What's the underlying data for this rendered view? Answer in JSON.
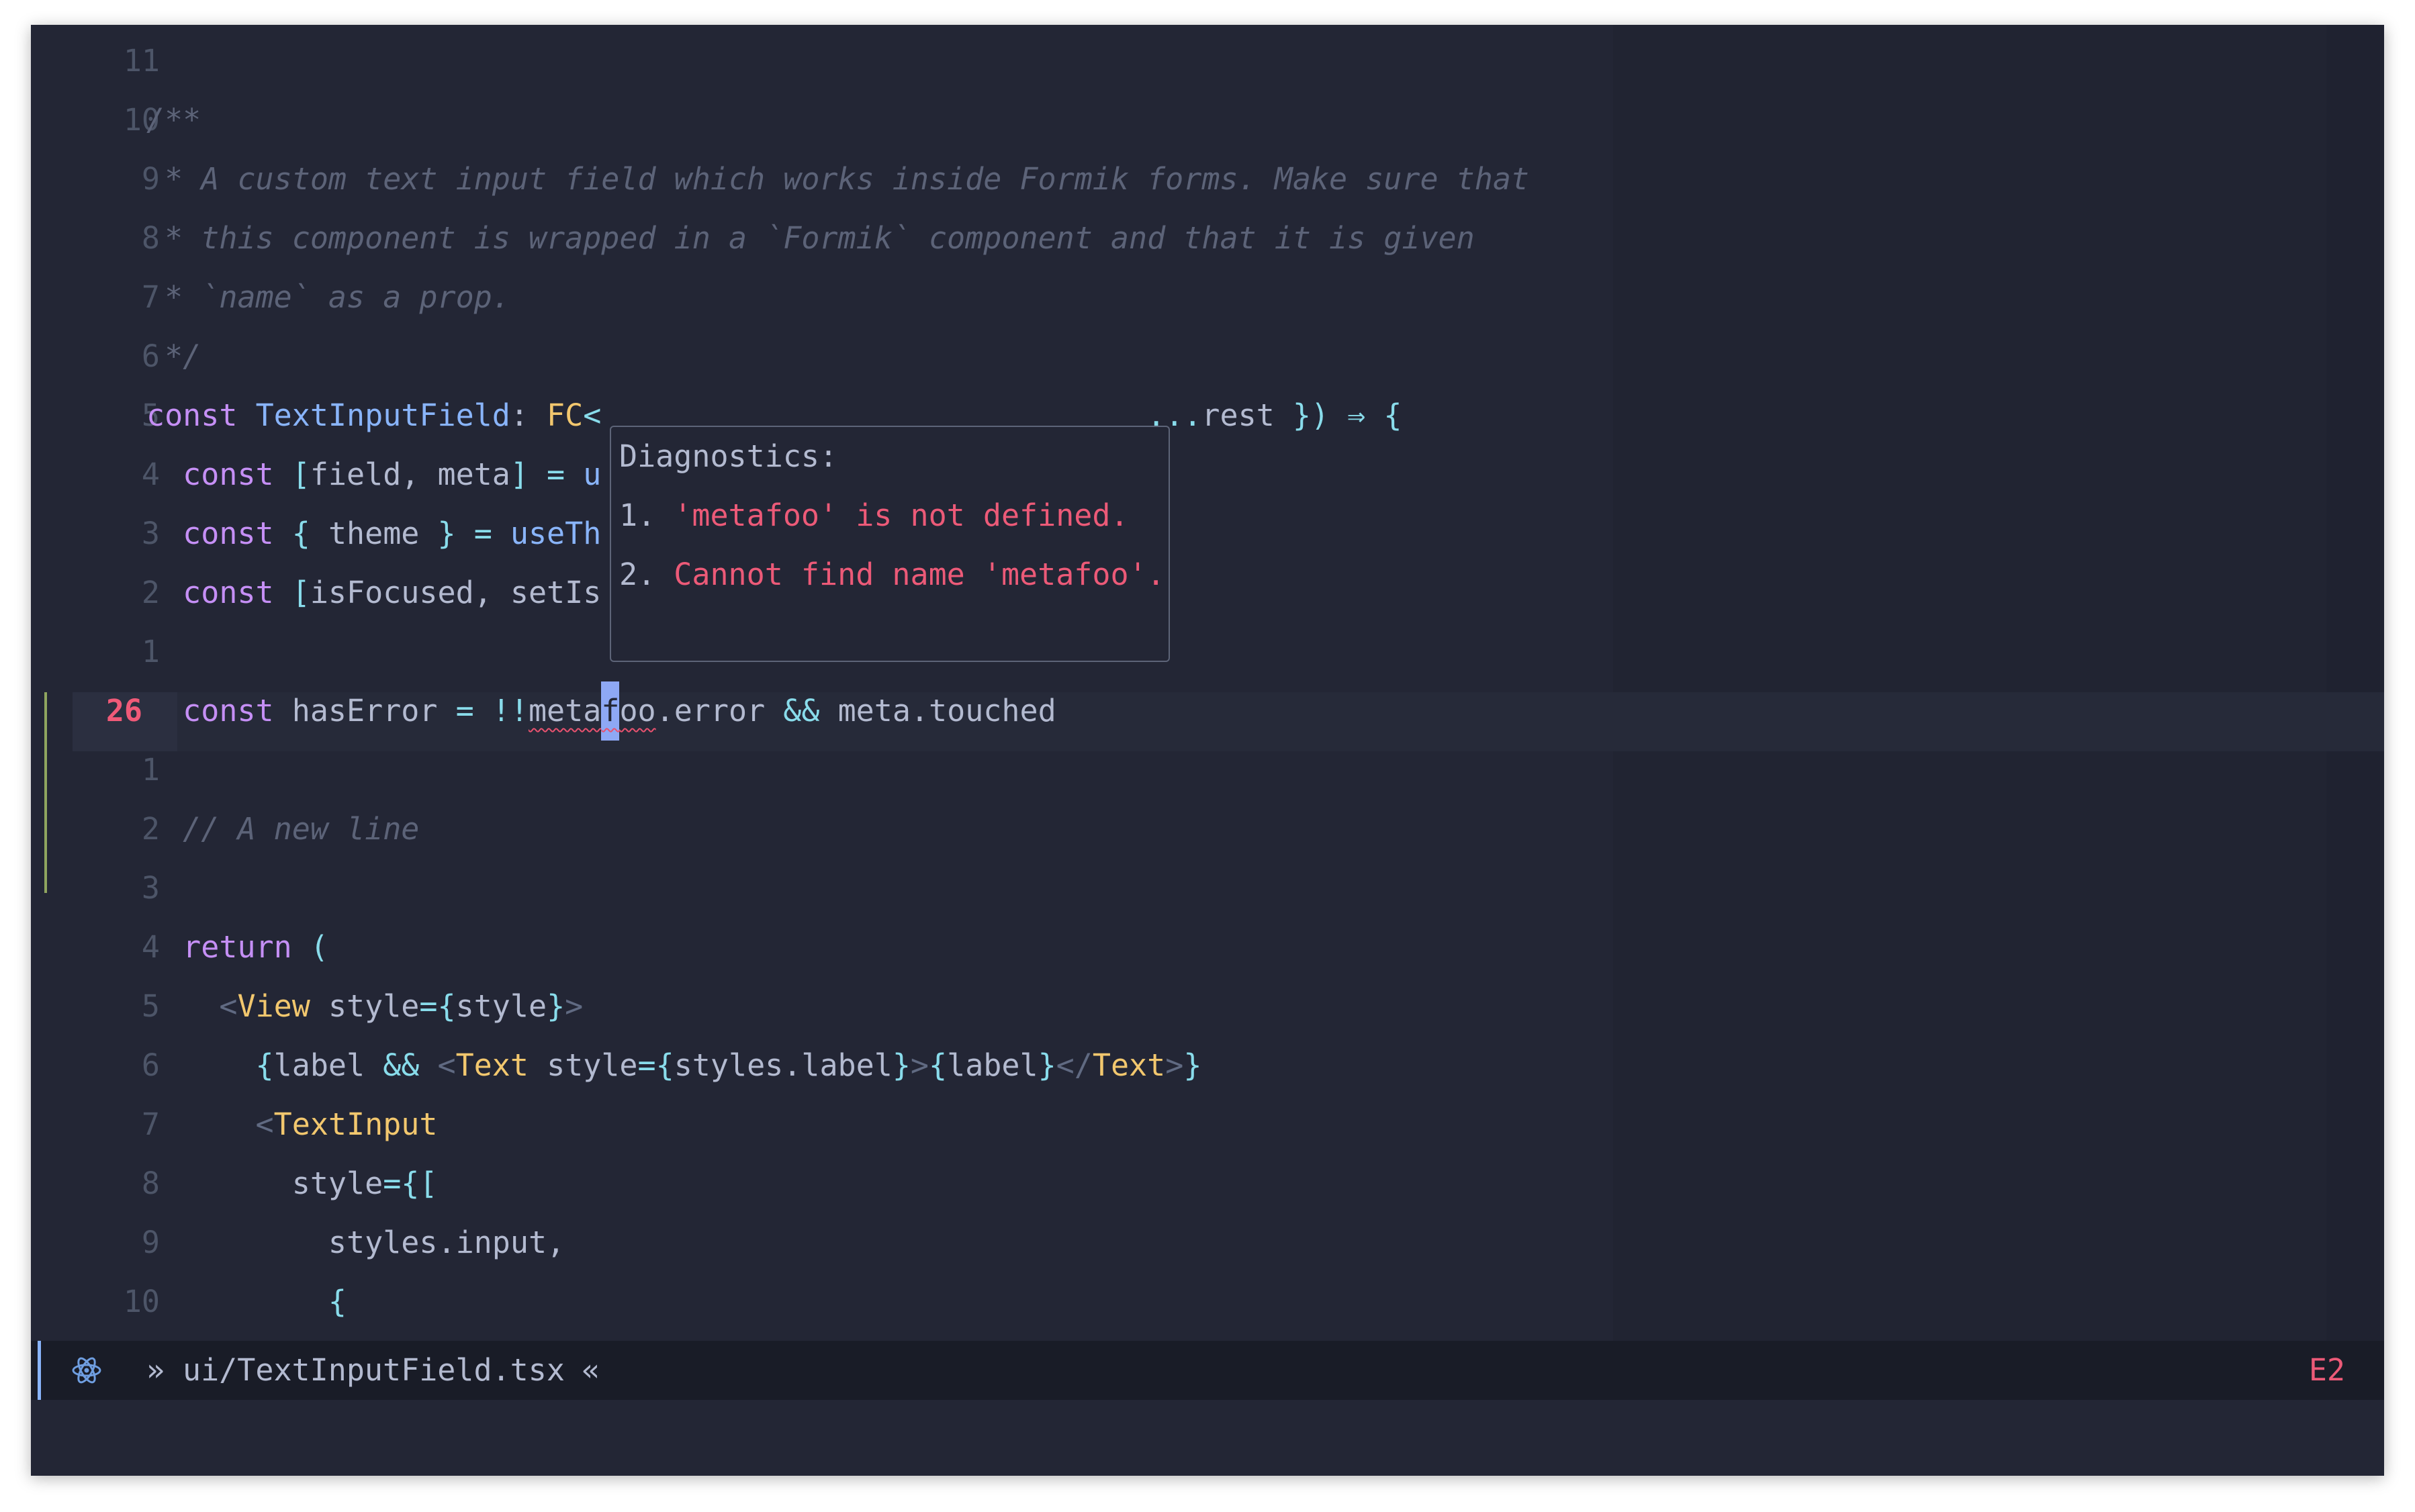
{
  "editor": {
    "lines": [
      {
        "num": "11",
        "tokens": []
      },
      {
        "num": "10",
        "tokens": [
          {
            "t": "/**",
            "c": "cm"
          }
        ]
      },
      {
        "num": "9",
        "tokens": [
          {
            "t": " * A custom text input field which works inside Formik forms. Make sure that",
            "c": "cm"
          }
        ]
      },
      {
        "num": "8",
        "tokens": [
          {
            "t": " * this component is wrapped in a `Formik` component and that it is given",
            "c": "cm"
          }
        ]
      },
      {
        "num": "7",
        "tokens": [
          {
            "t": " * `name` as a prop.",
            "c": "cm"
          }
        ]
      },
      {
        "num": "6",
        "tokens": [
          {
            "t": " */",
            "c": "cm"
          }
        ]
      },
      {
        "num": "5",
        "tokens": [
          {
            "t": "const ",
            "c": "kw"
          },
          {
            "t": "TextInputField",
            "c": "fn"
          },
          {
            "t": ": ",
            "c": "pl"
          },
          {
            "t": "FC",
            "c": "ty"
          },
          {
            "t": "<",
            "c": "op"
          },
          {
            "t": "                              ",
            "c": "pl"
          },
          {
            "t": "...",
            "c": "op"
          },
          {
            "t": "rest ",
            "c": "pl"
          },
          {
            "t": "}) ",
            "c": "op"
          },
          {
            "t": "⇒ ",
            "c": "op"
          },
          {
            "t": "{",
            "c": "op"
          }
        ]
      },
      {
        "num": "4",
        "tokens": [
          {
            "t": "  const ",
            "c": "kw"
          },
          {
            "t": "[",
            "c": "op"
          },
          {
            "t": "field, meta",
            "c": "pl"
          },
          {
            "t": "] ",
            "c": "op"
          },
          {
            "t": "= ",
            "c": "op"
          },
          {
            "t": "u",
            "c": "fn"
          }
        ]
      },
      {
        "num": "3",
        "tokens": [
          {
            "t": "  const ",
            "c": "kw"
          },
          {
            "t": "{ ",
            "c": "op"
          },
          {
            "t": "theme ",
            "c": "pl"
          },
          {
            "t": "} ",
            "c": "op"
          },
          {
            "t": "= ",
            "c": "op"
          },
          {
            "t": "useTh",
            "c": "fn"
          }
        ]
      },
      {
        "num": "2",
        "tokens": [
          {
            "t": "  const ",
            "c": "kw"
          },
          {
            "t": "[",
            "c": "op"
          },
          {
            "t": "isFocused, setIs",
            "c": "pl"
          }
        ]
      },
      {
        "num": "1",
        "tokens": []
      },
      {
        "num": "26",
        "current": true,
        "tokens": [
          {
            "t": "  const ",
            "c": "kw"
          },
          {
            "t": "hasError ",
            "c": "pl"
          },
          {
            "t": "= ",
            "c": "op"
          },
          {
            "t": "!!",
            "c": "op"
          },
          {
            "t": "meta",
            "c": "pl",
            "err": true
          },
          {
            "t": "f",
            "c": "pl",
            "err": true,
            "cursor": true
          },
          {
            "t": "oo",
            "c": "pl",
            "err": true
          },
          {
            "t": ".error ",
            "c": "pl"
          },
          {
            "t": "&& ",
            "c": "op"
          },
          {
            "t": "meta.touched",
            "c": "pl"
          }
        ]
      },
      {
        "num": "1",
        "tokens": []
      },
      {
        "num": "2",
        "tokens": [
          {
            "t": "  // A new line",
            "c": "cm"
          }
        ]
      },
      {
        "num": "3",
        "tokens": []
      },
      {
        "num": "4",
        "tokens": [
          {
            "t": "  return ",
            "c": "kw"
          },
          {
            "t": "(",
            "c": "op"
          }
        ]
      },
      {
        "num": "5",
        "tokens": [
          {
            "t": "    <",
            "c": "tg"
          },
          {
            "t": "View ",
            "c": "ty"
          },
          {
            "t": "style",
            "c": "pl"
          },
          {
            "t": "={",
            "c": "op"
          },
          {
            "t": "style",
            "c": "pl"
          },
          {
            "t": "}",
            "c": "op"
          },
          {
            "t": ">",
            "c": "tg"
          }
        ]
      },
      {
        "num": "6",
        "tokens": [
          {
            "t": "      {",
            "c": "op"
          },
          {
            "t": "label ",
            "c": "pl"
          },
          {
            "t": "&& ",
            "c": "op"
          },
          {
            "t": "<",
            "c": "tg"
          },
          {
            "t": "Text ",
            "c": "ty"
          },
          {
            "t": "style",
            "c": "pl"
          },
          {
            "t": "={",
            "c": "op"
          },
          {
            "t": "styles.label",
            "c": "pl"
          },
          {
            "t": "}",
            "c": "op"
          },
          {
            "t": ">",
            "c": "tg"
          },
          {
            "t": "{",
            "c": "op"
          },
          {
            "t": "label",
            "c": "pl"
          },
          {
            "t": "}",
            "c": "op"
          },
          {
            "t": "</",
            "c": "tg"
          },
          {
            "t": "Text",
            "c": "ty"
          },
          {
            "t": ">",
            "c": "tg"
          },
          {
            "t": "}",
            "c": "op"
          }
        ]
      },
      {
        "num": "7",
        "tokens": [
          {
            "t": "      <",
            "c": "tg"
          },
          {
            "t": "TextInput",
            "c": "ty"
          }
        ]
      },
      {
        "num": "8",
        "tokens": [
          {
            "t": "        style",
            "c": "pl"
          },
          {
            "t": "={[",
            "c": "op"
          }
        ]
      },
      {
        "num": "9",
        "tokens": [
          {
            "t": "          styles.input,",
            "c": "pl"
          }
        ]
      },
      {
        "num": "10",
        "tokens": [
          {
            "t": "          {",
            "c": "op"
          }
        ]
      }
    ]
  },
  "diagnostics_popup": {
    "title": "Diagnostics:",
    "items": [
      {
        "num": "1. ",
        "text": "'metafoo' is not defined."
      },
      {
        "num": "2. ",
        "text": "Cannot find name 'metafoo'."
      }
    ]
  },
  "statusbar": {
    "icon": "react-atom-icon",
    "arrow_left": "»",
    "file_path": "ui/TextInputField.tsx",
    "arrow_right": "«",
    "error_count": "E2"
  },
  "colors": {
    "background": "#232635",
    "keyword": "#c58ff5",
    "function": "#89b4fa",
    "type": "#f2c76e",
    "operator": "#89dceb",
    "comment": "#5c6378",
    "error": "#ec5a78",
    "git_added": "#8fa55f"
  }
}
